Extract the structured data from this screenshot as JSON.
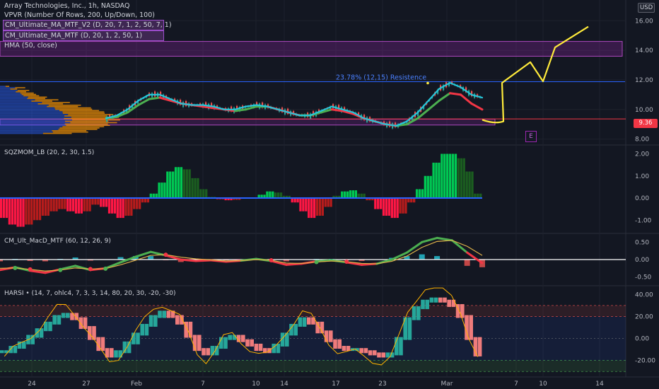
{
  "header": {
    "title": "Array Technologies, Inc., 1h, NASDAQ",
    "indicators": [
      "VPVR (Number Of Rows, 200, Up/Down, 100)",
      "CM_Ultimate_MA_MTF_V2 (D, 20, 7, 1, 2, 50, 7, 1)",
      "CM_Ultimate_MA_MTF (D, 20, 1, 2, 50, 1)",
      "HMA (50, close)"
    ]
  },
  "currency": "USD",
  "last_price": "9.36",
  "event_marker": "E",
  "colors": {
    "background": "#131722",
    "up": "#26a69a",
    "down": "#ef5350",
    "ma_up": "#4caf50",
    "ma_down": "#f23645",
    "hma": "#26c6da",
    "drawing": "#ffeb3b",
    "zone": "#9c27b0",
    "resistance": "#2962ff"
  },
  "chart_data": [
    {
      "type": "line",
      "pane": "price",
      "title": "Array Technologies, Inc., 1h, NASDAQ",
      "y_ticks": [
        "16.00",
        "14.00",
        "12.00",
        "10.00",
        "8.00"
      ],
      "ylim": [
        7.6,
        17.4
      ],
      "x": [
        0,
        8,
        16,
        24,
        32,
        40,
        48,
        56,
        64,
        72,
        80,
        88,
        96,
        104,
        112,
        120,
        128,
        136,
        144,
        152,
        160,
        168,
        176,
        184,
        192,
        200,
        208,
        216,
        224,
        232,
        240,
        248,
        256,
        264,
        272,
        280
      ],
      "series": [
        {
          "name": "HMA",
          "values": [
            9.4,
            9.6,
            10.0,
            10.6,
            11.0,
            11.0,
            10.7,
            10.4,
            10.3,
            10.3,
            10.2,
            10.0,
            10.0,
            10.2,
            10.3,
            10.2,
            10.0,
            9.8,
            9.6,
            9.6,
            9.9,
            10.2,
            10.0,
            9.8,
            9.4,
            9.2,
            9.0,
            8.9,
            9.2,
            9.8,
            10.6,
            11.4,
            11.8,
            11.5,
            11.0,
            10.8
          ]
        },
        {
          "name": "CM_Ultimate_MA_MTF",
          "values": [
            9.4,
            9.5,
            9.8,
            10.3,
            10.7,
            10.8,
            10.6,
            10.4,
            10.3,
            10.2,
            10.1,
            10.0,
            9.9,
            10.0,
            10.2,
            10.2,
            10.0,
            9.8,
            9.6,
            9.6,
            9.8,
            10.0,
            9.9,
            9.7,
            9.4,
            9.2,
            9.0,
            8.9,
            9.0,
            9.4,
            10.0,
            10.6,
            11.1,
            11.0,
            10.4,
            10.0
          ]
        }
      ],
      "annotations": [
        "23.78% (12,15) Resistence"
      ],
      "resistance_level": 11.88,
      "zones": [
        [
          13.6,
          14.6
        ],
        [
          8.95,
          9.35
        ]
      ],
      "projection": [
        10.6,
        11.8,
        13.2,
        11.9,
        14.2,
        15.6
      ]
    },
    {
      "type": "bar",
      "pane": "SQZMOM",
      "title": "SQZMOM_LB (20, 2, 30, 1.5)",
      "y_ticks": [
        "2.00",
        "1.00",
        "0.00",
        "-1.00"
      ],
      "ylim": [
        -1.6,
        2.4
      ],
      "values": [
        -0.9,
        -1.2,
        -1.3,
        -1.2,
        -1.0,
        -0.8,
        -0.6,
        -0.5,
        -0.6,
        -0.7,
        -0.6,
        -0.3,
        -0.4,
        -0.7,
        -0.9,
        -0.8,
        -0.5,
        -0.2,
        0.2,
        0.7,
        1.2,
        1.4,
        1.3,
        0.9,
        0.4,
        0.05,
        -0.05,
        -0.1,
        -0.08,
        -0.03,
        0.03,
        0.15,
        0.3,
        0.25,
        0.1,
        -0.2,
        -0.6,
        -0.9,
        -0.8,
        -0.4,
        0.1,
        0.3,
        0.35,
        0.2,
        -0.1,
        -0.5,
        -0.8,
        -0.9,
        -0.7,
        -0.2,
        0.4,
        1.0,
        1.6,
        2.0,
        2.0,
        1.8,
        1.2,
        0.2
      ]
    },
    {
      "type": "line",
      "pane": "MACD",
      "title": "CM_Ult_MacD_MTF (60, 12, 26, 9)",
      "y_ticks": [
        "0.50",
        "0.00",
        "-0.50"
      ],
      "ylim": [
        -0.75,
        0.75
      ],
      "series": [
        {
          "name": "MACD",
          "values": [
            -0.3,
            -0.22,
            -0.32,
            -0.38,
            -0.28,
            -0.18,
            -0.3,
            -0.25,
            -0.08,
            0.08,
            0.22,
            0.12,
            0.0,
            -0.04,
            -0.02,
            -0.06,
            -0.03,
            0.02,
            -0.04,
            -0.15,
            -0.12,
            -0.05,
            -0.02,
            -0.08,
            -0.15,
            -0.12,
            0.0,
            0.2,
            0.5,
            0.62,
            0.55,
            0.2,
            -0.1
          ]
        },
        {
          "name": "Signal",
          "values": [
            -0.25,
            -0.24,
            -0.28,
            -0.33,
            -0.3,
            -0.24,
            -0.27,
            -0.26,
            -0.15,
            -0.02,
            0.12,
            0.14,
            0.07,
            0.02,
            -0.01,
            -0.04,
            -0.03,
            0.0,
            -0.02,
            -0.1,
            -0.11,
            -0.07,
            -0.04,
            -0.06,
            -0.11,
            -0.12,
            -0.05,
            0.1,
            0.35,
            0.52,
            0.55,
            0.38,
            0.12
          ]
        }
      ]
    },
    {
      "type": "bar",
      "pane": "HARSI",
      "title": "HARSI • (14, 7, ohlc4, 7, 3, 3, 14, 80, 20, 30, -20, -30)",
      "y_ticks": [
        "40.00",
        "20.00",
        "0.00",
        "-20.00"
      ],
      "ylim": [
        -35,
        48
      ],
      "values": [
        -12,
        -8,
        -4,
        2,
        8,
        14,
        20,
        22,
        18,
        10,
        0,
        -10,
        -16,
        -12,
        -4,
        4,
        12,
        20,
        24,
        20,
        14,
        2,
        -10,
        -14,
        -8,
        0,
        2,
        -2,
        -6,
        -10,
        -12,
        -6,
        4,
        12,
        18,
        14,
        6,
        -2,
        -8,
        -10,
        -10,
        -12,
        -14,
        -16,
        -14,
        0,
        18,
        28,
        34,
        36,
        34,
        30,
        20,
        0,
        -15
      ]
    }
  ],
  "x_axis": {
    "labels": [
      "24",
      "27",
      "Feb",
      "7",
      "10",
      "14",
      "17",
      "23",
      "Mar",
      "7",
      "10",
      "14"
    ]
  }
}
